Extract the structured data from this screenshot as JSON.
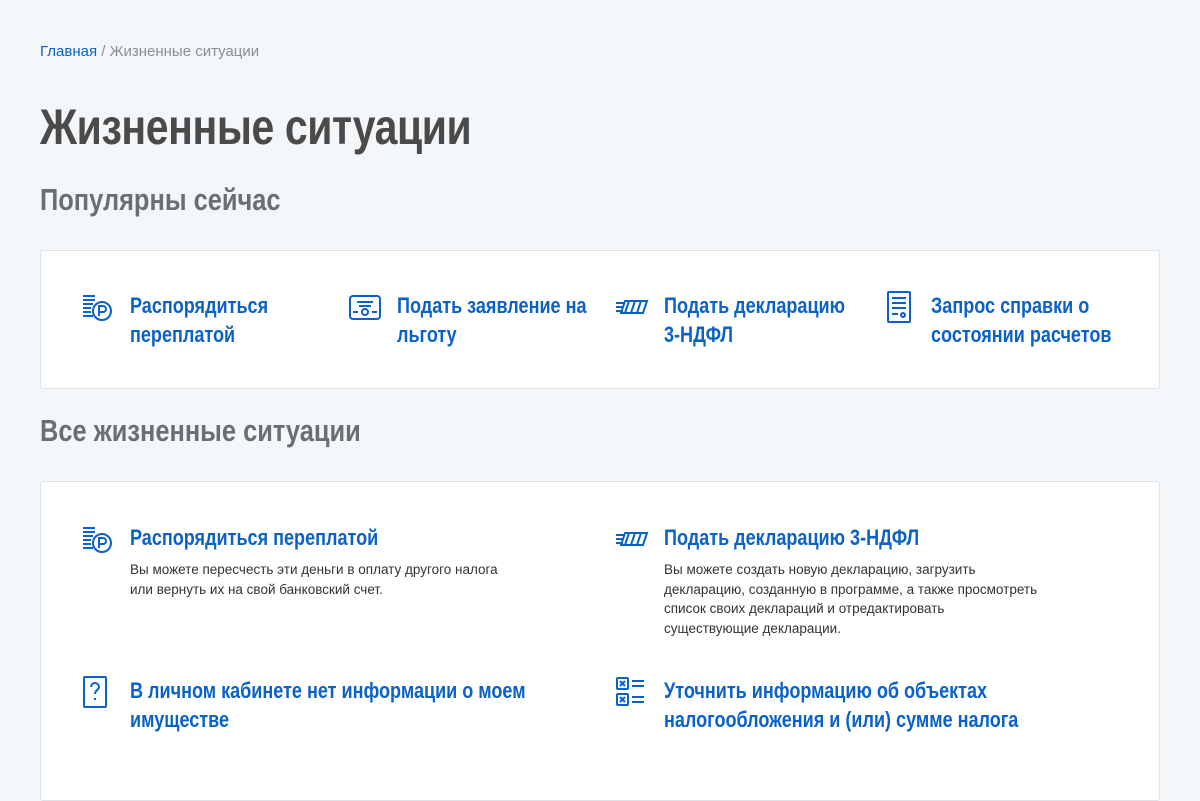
{
  "breadcrumb": {
    "home": "Главная",
    "separator": " / ",
    "current": "Жизненные ситуации"
  },
  "page_title": "Жизненные ситуации",
  "popular": {
    "heading": "Популярны сейчас",
    "items": [
      {
        "icon": "coins-ruble-icon",
        "line1": "Распорядиться",
        "line2": "переплатой"
      },
      {
        "icon": "certificate-icon",
        "line1": "Подать заявление на",
        "line2": "льготу"
      },
      {
        "icon": "stack-documents-icon",
        "line1": "Подать декларацию",
        "line2": "3-НДФЛ"
      },
      {
        "icon": "document-list-icon",
        "line1": "Запрос справки о",
        "line2": "состоянии расчетов"
      }
    ]
  },
  "all": {
    "heading": "Все жизненные ситуации",
    "items": [
      {
        "icon": "coins-ruble-icon",
        "title": "Распорядиться переплатой",
        "desc1": "Вы можете пересчесть эти деньги в оплату другого налога",
        "desc2": "или вернуть их на свой банковский счет."
      },
      {
        "icon": "stack-documents-icon",
        "title": "Подать декларацию 3-НДФЛ",
        "desc1": "Вы можете создать новую декларацию, загрузить",
        "desc2": "декларацию, созданную в программе, а также просмотреть",
        "desc3": "список своих деклараций и отредактировать",
        "desc4": "существующие декларации."
      },
      {
        "icon": "question-icon",
        "line1": "В личном кабинете нет информации о моем",
        "line2": "имуществе"
      },
      {
        "icon": "checklist-icon",
        "line1": "Уточнить информацию об объектах",
        "line2": "налогообложения и (или) сумме налога"
      }
    ]
  },
  "colors": {
    "accent": "#0a62c9",
    "background": "#f4f7fa"
  }
}
